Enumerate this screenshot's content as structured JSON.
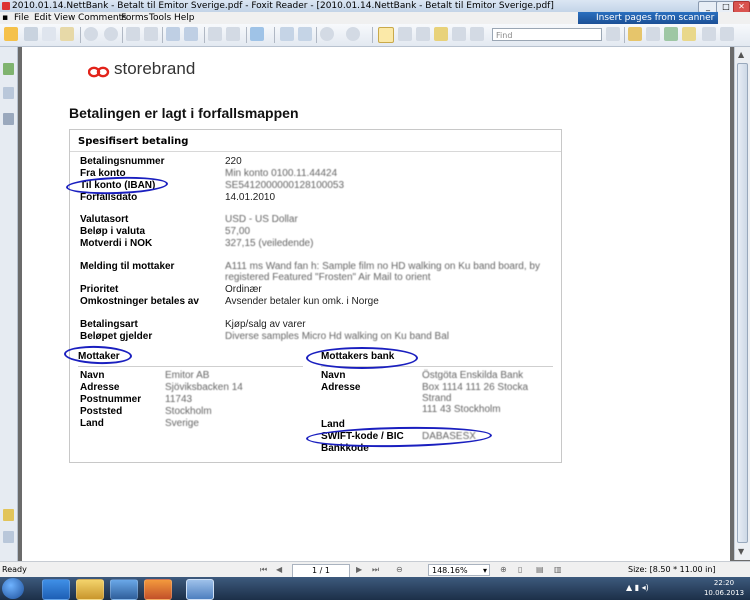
{
  "window": {
    "title": "2010.01.14.NettBank - Betalt til Emitor Sverige.pdf - Foxit Reader - [2010.01.14.NettBank - Betalt til Emitor Sverige.pdf]",
    "ad_banner": "Insert pages from scanner"
  },
  "menu": [
    "File",
    "Edit",
    "View",
    "Comments",
    "Forms",
    "Tools",
    "Help"
  ],
  "toolbar": {
    "find_placeholder": "Find"
  },
  "document": {
    "logo": "storebrand",
    "heading": "Betalingen er lagt i forfallsmappen",
    "panel_title": "Spesifisert betaling",
    "fields": [
      {
        "label": "Betalingsnummer",
        "value": "220"
      },
      {
        "label": "Fra konto",
        "value": "Min konto 0100.11.44424"
      },
      {
        "label": "Til konto (IBAN)",
        "value": "SE5412000000128100053"
      },
      {
        "label": "Forfallsdato",
        "value": "14.01.2010"
      },
      {
        "label": "Valutasort",
        "value": "USD - US Dollar"
      },
      {
        "label": "Beløp i valuta",
        "value": "57,00"
      },
      {
        "label": "Motverdi i NOK",
        "value": "327,15 (veiledende)"
      },
      {
        "label": "Melding til mottaker",
        "value": "A111 ms Wand fan h: Sample film no HD walking on Ku band board, by",
        "value2": "registered Featured \"Frosten\" Air Mail to orient"
      },
      {
        "label": "Prioritet",
        "value": "Ordinær"
      },
      {
        "label": "Omkostninger betales av",
        "value": "Avsender betaler kun omk. i Norge"
      },
      {
        "label": "Betalingsart",
        "value": "Kjøp/salg av varer"
      },
      {
        "label": "Beløpet gjelder",
        "value": "Diverse samples Micro Hd walking on Ku band Bal"
      }
    ],
    "mottaker": {
      "title": "Mottaker",
      "rows": [
        {
          "label": "Navn",
          "value": "Emitor AB"
        },
        {
          "label": "Adresse",
          "value": "Sjöviksbacken 14"
        },
        {
          "label": "Postnummer",
          "value": "11743"
        },
        {
          "label": "Poststed",
          "value": "Stockholm"
        },
        {
          "label": "Land",
          "value": "Sverige"
        }
      ]
    },
    "bank": {
      "title": "Mottakers bank",
      "rows": [
        {
          "label": "Navn",
          "value": "Östgöta Enskilda Bank"
        },
        {
          "label": "Adresse",
          "value": "Box 1114 111 26 Stocka",
          "value2": "Strand",
          "value3": "111 43 Stockholm"
        },
        {
          "label": "Land",
          "value": ""
        },
        {
          "label": "SWIFT-kode / BIC",
          "value": "DABASESX"
        },
        {
          "label": "Bankkode",
          "value": ""
        }
      ]
    }
  },
  "statusbar": {
    "left": "Ready",
    "page": "1 / 1",
    "zoom": "148.16%",
    "size": "Size: [8.50 * 11.00 in]"
  },
  "taskbar": {
    "time": "22:20",
    "date": "10.06.2013"
  },
  "colors": {
    "ink_annotation": "#1a1fbf",
    "brand_red": "#e2231a"
  }
}
